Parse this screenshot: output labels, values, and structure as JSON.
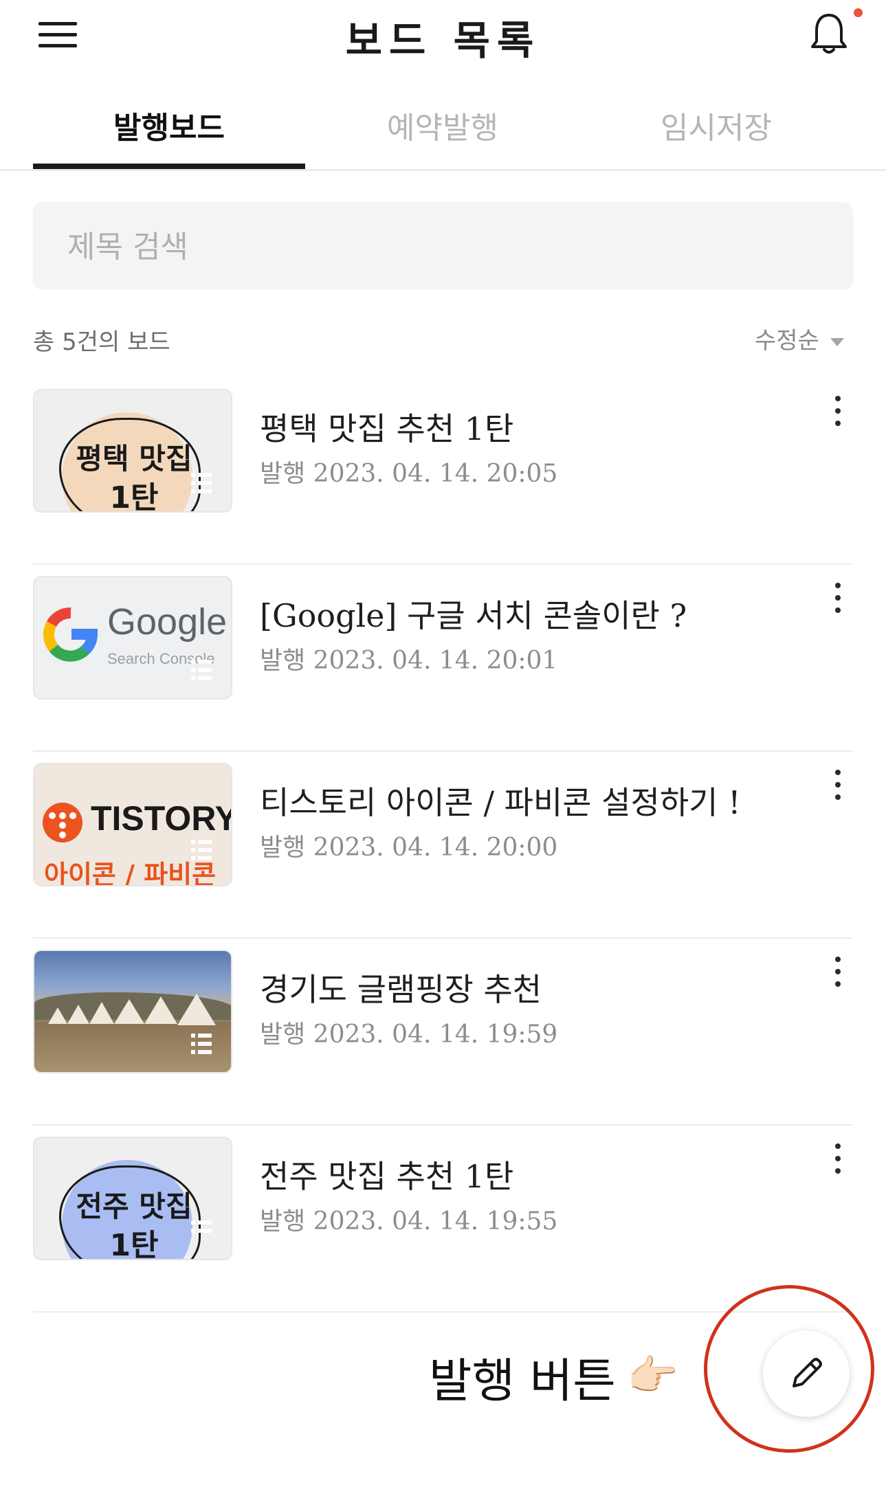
{
  "header": {
    "title": "보드 목록",
    "menu_icon": "hamburger-menu-icon",
    "notification_icon": "bell-icon",
    "notification_dot_color": "#e8553e"
  },
  "tabs": [
    {
      "label": "발행보드",
      "active": true
    },
    {
      "label": "예약발행",
      "active": false
    },
    {
      "label": "임시저장",
      "active": false
    }
  ],
  "search": {
    "placeholder": "제목 검색",
    "value": ""
  },
  "summary": {
    "count_text": "총 5건의 보드",
    "sort_label": "수정순"
  },
  "posts": [
    {
      "title": "평택 맛집 추천 1탄",
      "date": "발행 2023. 04. 14. 20:05",
      "thumb_line1": "평택 맛집",
      "thumb_line2": "1탄",
      "thumb_accent": "#f3d8bc"
    },
    {
      "title": "[Google] 구글 서치 콘솔이란 ?",
      "date": "발행 2023. 04. 14. 20:01",
      "thumb_word": "Google",
      "thumb_sub": "Search Console"
    },
    {
      "title": "티스토리 아이콘 / 파비콘 설정하기 !",
      "date": "발행 2023. 04. 14. 20:00",
      "thumb_word": "TISTORY",
      "thumb_sub": "아이콘 / 파비콘"
    },
    {
      "title": "경기도 글램핑장 추천",
      "date": "발행 2023. 04. 14. 19:59"
    },
    {
      "title": "전주 맛집 추천 1탄",
      "date": "발행 2023. 04. 14. 19:55",
      "thumb_line1": "전주 맛집",
      "thumb_line2": "1탄",
      "thumb_accent": "#a9bdf2"
    }
  ],
  "write": {
    "annotation_label": "발행 버튼",
    "annotation_emoji": "👉🏻",
    "button_icon": "pencil-icon",
    "highlight_color": "#d0321c"
  }
}
